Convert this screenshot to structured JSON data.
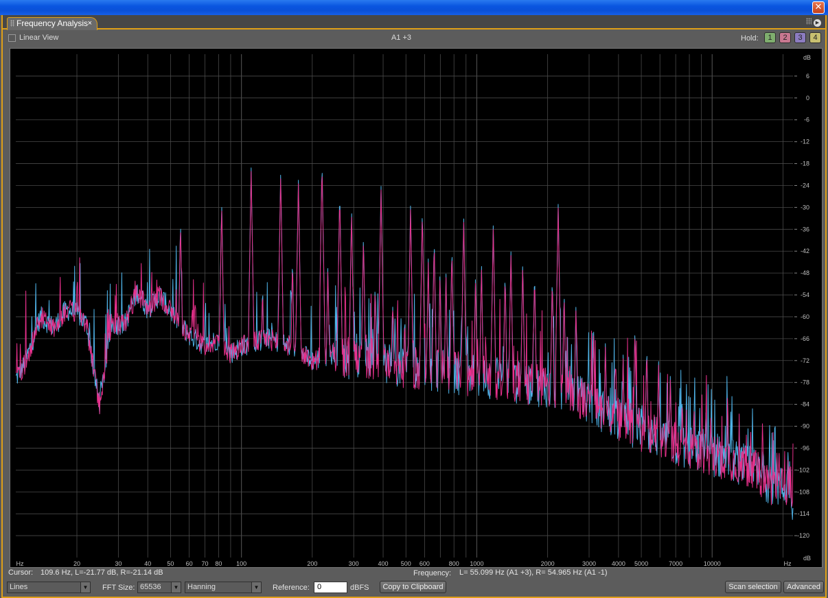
{
  "window": {
    "close_glyph": "✕"
  },
  "tab": {
    "title": "Frequency Analysis",
    "close_glyph": "×"
  },
  "header": {
    "linear_view_label": "Linear View",
    "linear_view_checked": false,
    "channel_label": "A1 +3",
    "hold_label": "Hold:",
    "hold_buttons": [
      {
        "label": "1",
        "color": "#7fae6e"
      },
      {
        "label": "2",
        "color": "#c87890"
      },
      {
        "label": "3",
        "color": "#8c7cc0"
      },
      {
        "label": "4",
        "color": "#c8c070"
      }
    ]
  },
  "plot": {
    "background": "#000000",
    "grid_color": "#4a4a4a",
    "left_channel_color": "#4fb3e8",
    "right_channel_color": "#e8308c",
    "x_unit": "Hz",
    "x_scale": "log",
    "x_range": [
      11,
      22050
    ],
    "x_ticks": [
      "20",
      "30",
      "40",
      "50",
      "60",
      "70",
      "80",
      "100",
      "200",
      "300",
      "400",
      "500",
      "600",
      "800",
      "1000",
      "2000",
      "3000",
      "4000",
      "5000",
      "7000",
      "10000"
    ],
    "y_unit": "dB",
    "y_range": [
      -126,
      12
    ],
    "y_ticks": [
      "6",
      "0",
      "-6",
      "-12",
      "-18",
      "-24",
      "-30",
      "-36",
      "-42",
      "-48",
      "-54",
      "-60",
      "-66",
      "-72",
      "-78",
      "-84",
      "-90",
      "-96",
      "-102",
      "-108",
      "-114",
      "-120"
    ]
  },
  "chart_data": {
    "type": "line",
    "xlabel": "Hz",
    "ylabel": "dB",
    "x_scale": "log",
    "xlim": [
      11,
      22050
    ],
    "ylim": [
      -126,
      12
    ],
    "baseline": [
      [
        11,
        -77
      ],
      [
        12,
        -73
      ],
      [
        14,
        -60
      ],
      [
        16,
        -63
      ],
      [
        18,
        -58
      ],
      [
        20,
        -59
      ],
      [
        22,
        -62
      ],
      [
        24,
        -78
      ],
      [
        25,
        -84
      ],
      [
        28,
        -62
      ],
      [
        32,
        -62
      ],
      [
        36,
        -53
      ],
      [
        40,
        -58
      ],
      [
        45,
        -54
      ],
      [
        52,
        -60
      ],
      [
        60,
        -65
      ],
      [
        70,
        -68
      ],
      [
        80,
        -66
      ],
      [
        90,
        -70
      ],
      [
        100,
        -68
      ],
      [
        130,
        -66
      ],
      [
        160,
        -68
      ],
      [
        200,
        -72
      ],
      [
        250,
        -70
      ],
      [
        300,
        -72
      ],
      [
        400,
        -72
      ],
      [
        500,
        -74
      ],
      [
        700,
        -75
      ],
      [
        1000,
        -76
      ],
      [
        1500,
        -78
      ],
      [
        2000,
        -79
      ],
      [
        2500,
        -80
      ],
      [
        3000,
        -84
      ],
      [
        4000,
        -88
      ],
      [
        5000,
        -91
      ],
      [
        6000,
        -93
      ],
      [
        7000,
        -95
      ],
      [
        8000,
        -96
      ],
      [
        10000,
        -98
      ],
      [
        12000,
        -99
      ],
      [
        15000,
        -102
      ],
      [
        18000,
        -106
      ],
      [
        20000,
        -107
      ],
      [
        21500,
        -104
      ],
      [
        22050,
        -112
      ]
    ],
    "peaks": [
      [
        55.1,
        -33
      ],
      [
        82.4,
        -28
      ],
      [
        110,
        -19
      ],
      [
        123,
        -50
      ],
      [
        146.8,
        -20
      ],
      [
        164.8,
        -43
      ],
      [
        174.6,
        -22
      ],
      [
        220,
        -17
      ],
      [
        233,
        -45
      ],
      [
        261.6,
        -25
      ],
      [
        293.7,
        -30
      ],
      [
        330,
        -37
      ],
      [
        370,
        -50
      ],
      [
        392,
        -24
      ],
      [
        440,
        -55
      ],
      [
        494,
        -58
      ],
      [
        523,
        -29
      ],
      [
        587,
        -30
      ],
      [
        622,
        -44
      ],
      [
        659,
        -38
      ],
      [
        698,
        -47
      ],
      [
        740,
        -48
      ],
      [
        784,
        -40
      ],
      [
        880,
        -32
      ],
      [
        988,
        -48
      ],
      [
        1047,
        -45
      ],
      [
        1175,
        -34
      ],
      [
        1319,
        -47
      ],
      [
        1397,
        -42
      ],
      [
        1568,
        -44
      ],
      [
        1760,
        -47
      ],
      [
        2093,
        -48
      ],
      [
        2217,
        -29
      ],
      [
        2349,
        -52
      ],
      [
        2637,
        -57
      ],
      [
        3136,
        -63
      ],
      [
        3520,
        -66
      ],
      [
        4186,
        -70
      ],
      [
        4699,
        -62
      ],
      [
        5274,
        -67
      ],
      [
        5920,
        -71
      ],
      [
        6645,
        -75
      ],
      [
        7459,
        -80
      ],
      [
        8372,
        -82
      ],
      [
        9398,
        -86
      ],
      [
        10548,
        -90
      ],
      [
        11840,
        -93
      ],
      [
        13290,
        -94
      ],
      [
        14917,
        -96
      ]
    ],
    "cursor": {
      "frequency_hz": 109.6,
      "left_db": -21.77,
      "right_db": -21.14
    },
    "series": []
  },
  "status": {
    "cursor_label": "Cursor:",
    "cursor_value": "109.6 Hz, L=-21.77 dB, R=-21.14 dB",
    "frequency_label": "Frequency:",
    "frequency_value": "L= 55.099 Hz (A1 +3), R= 54.965 Hz (A1 -1)"
  },
  "toolbar": {
    "graph_style": "Lines",
    "fft_size_label": "FFT Size:",
    "fft_size": "65536",
    "window_function": "Hanning",
    "reference_label": "Reference:",
    "reference_value": "0",
    "reference_unit": "dBFS",
    "copy_button": "Copy to Clipboard",
    "scan_button": "Scan selection",
    "advanced_button": "Advanced"
  },
  "icons": {
    "dropdown": "chevron-down-icon",
    "panel_menu": "play-icon"
  }
}
